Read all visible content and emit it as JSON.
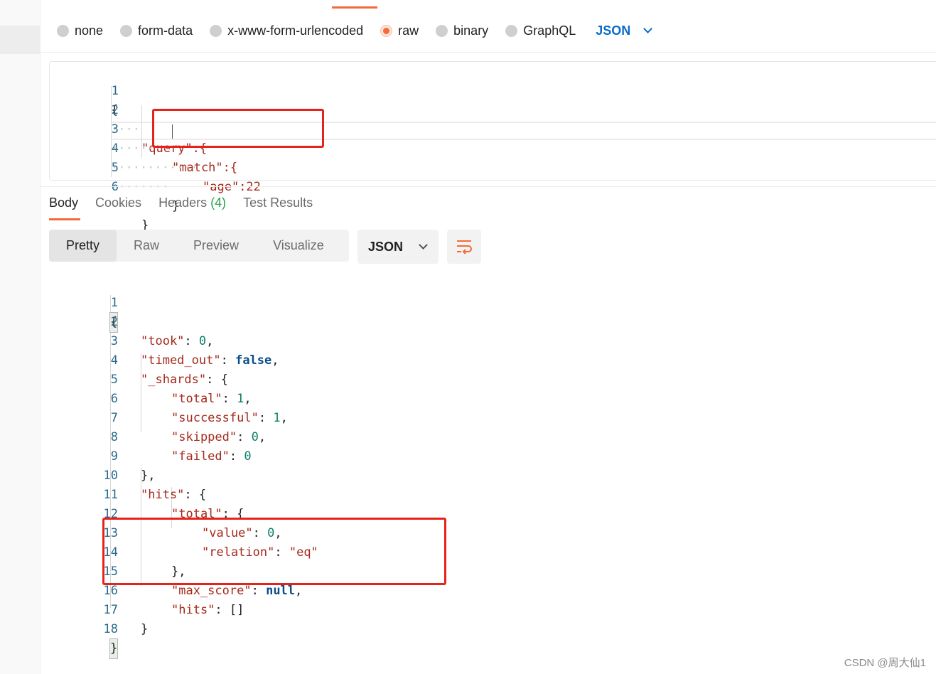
{
  "body_type_options": [
    {
      "label": "none",
      "selected": false
    },
    {
      "label": "form-data",
      "selected": false
    },
    {
      "label": "x-www-form-urlencoded",
      "selected": false
    },
    {
      "label": "raw",
      "selected": true
    },
    {
      "label": "binary",
      "selected": false
    },
    {
      "label": "GraphQL",
      "selected": false
    }
  ],
  "raw_language": "JSON",
  "request_editor": {
    "lines": [
      {
        "n": "1",
        "code": "{"
      },
      {
        "n": "2",
        "code": "\"query\":{"
      },
      {
        "n": "3",
        "code": "\"match\":{"
      },
      {
        "n": "4",
        "code": "\"age\":22"
      },
      {
        "n": "5",
        "code": "}"
      },
      {
        "n": "6",
        "code": "}"
      }
    ]
  },
  "response_tabs": {
    "body": "Body",
    "cookies": "Cookies",
    "headers": "Headers",
    "headers_count": "(4)",
    "test_results": "Test Results"
  },
  "view_modes": [
    "Pretty",
    "Raw",
    "Preview",
    "Visualize"
  ],
  "response_format": "JSON",
  "response_editor": {
    "lines": [
      {
        "n": "1",
        "code": "{"
      },
      {
        "n": "2",
        "code": "\"took\": 0,"
      },
      {
        "n": "3",
        "code": "\"timed_out\": false,"
      },
      {
        "n": "4",
        "code": "\"_shards\": {"
      },
      {
        "n": "5",
        "code": "\"total\": 1,"
      },
      {
        "n": "6",
        "code": "\"successful\": 1,"
      },
      {
        "n": "7",
        "code": "\"skipped\": 0,"
      },
      {
        "n": "8",
        "code": "\"failed\": 0"
      },
      {
        "n": "9",
        "code": "},"
      },
      {
        "n": "10",
        "code": "\"hits\": {"
      },
      {
        "n": "11",
        "code": "\"total\": {"
      },
      {
        "n": "12",
        "code": "\"value\": 0,"
      },
      {
        "n": "13",
        "code": "\"relation\": \"eq\""
      },
      {
        "n": "14",
        "code": "},"
      },
      {
        "n": "15",
        "code": "\"max_score\": null,"
      },
      {
        "n": "16",
        "code": "\"hits\": []"
      },
      {
        "n": "17",
        "code": "}"
      },
      {
        "n": "18",
        "code": "}"
      }
    ]
  },
  "watermark": "CSDN @周大仙1",
  "colors": {
    "accent": "#f26b3a",
    "link_blue": "#0b6bcb",
    "json_key": "#a5291b",
    "json_number": "#0b7f6a",
    "json_keyword": "#0a4d8c",
    "annotation_red": "#e8221b",
    "count_green": "#22a54a"
  }
}
